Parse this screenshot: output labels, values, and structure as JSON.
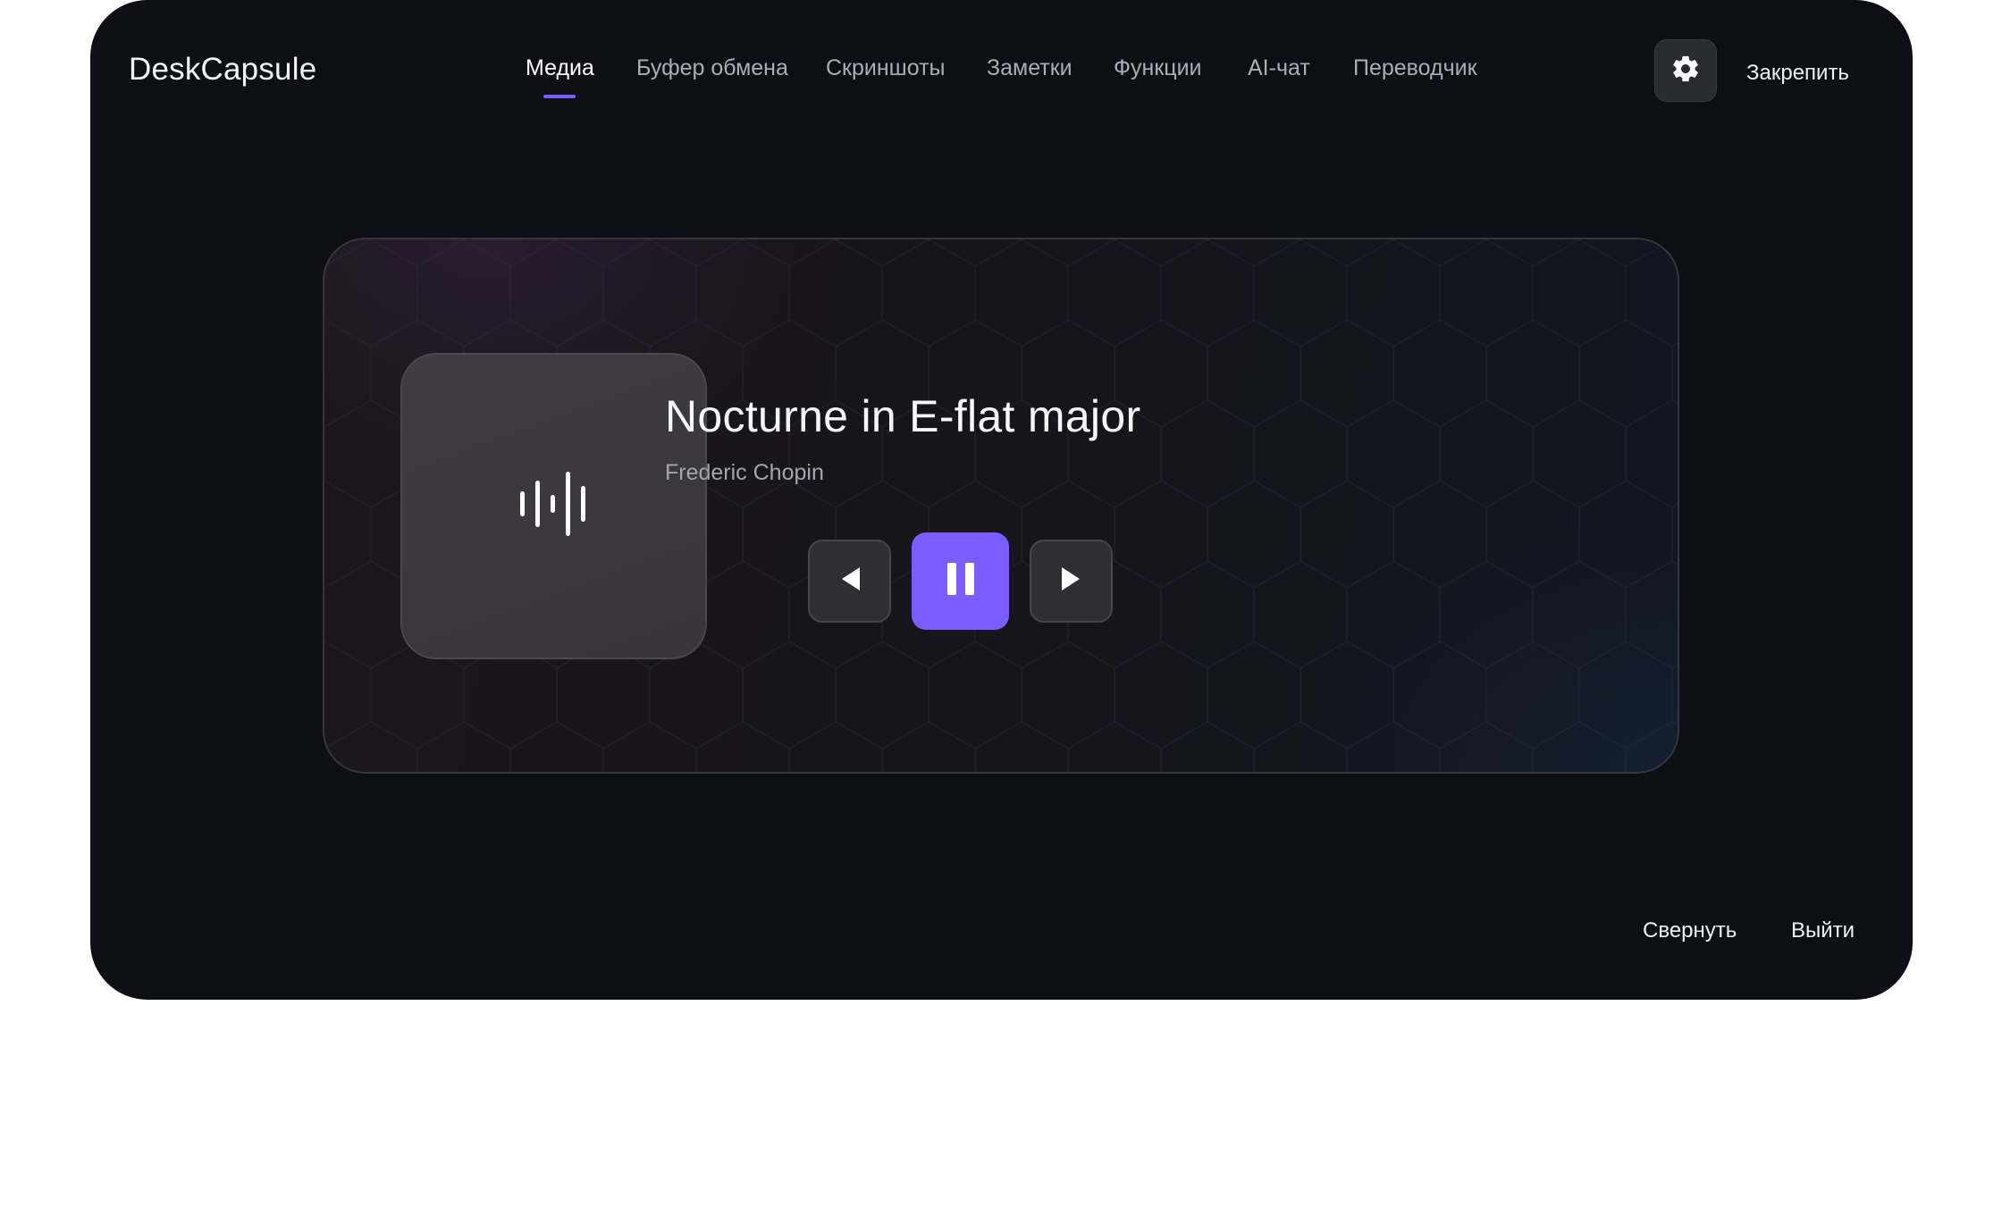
{
  "app": {
    "brand": "DeskCapsule"
  },
  "nav": {
    "items": [
      {
        "label": "Медиа",
        "active": true
      },
      {
        "label": "Буфер обмена",
        "active": false
      },
      {
        "label": "Скриншоты",
        "active": false
      },
      {
        "label": "Заметки",
        "active": false
      },
      {
        "label": "Функции",
        "active": false
      },
      {
        "label": "AI-чат",
        "active": false
      },
      {
        "label": "Переводчик",
        "active": false
      }
    ]
  },
  "header": {
    "settings_icon": "gear-icon",
    "pin_label": "Закрепить"
  },
  "player": {
    "art_icon": "sound-wave-icon",
    "title": "Nocturne in E-flat major",
    "artist": "Frederic Chopin",
    "controls": {
      "prev_icon": "previous-icon",
      "play_state_icon": "pause-icon",
      "next_icon": "next-icon"
    }
  },
  "footer": {
    "minimize_label": "Свернуть",
    "exit_label": "Выйти"
  },
  "colors": {
    "background": "#0e0f14",
    "accent": "#7a5cff",
    "text_primary": "#ffffff",
    "text_secondary": "#a9adb8",
    "page_margin": "#ffffff"
  }
}
